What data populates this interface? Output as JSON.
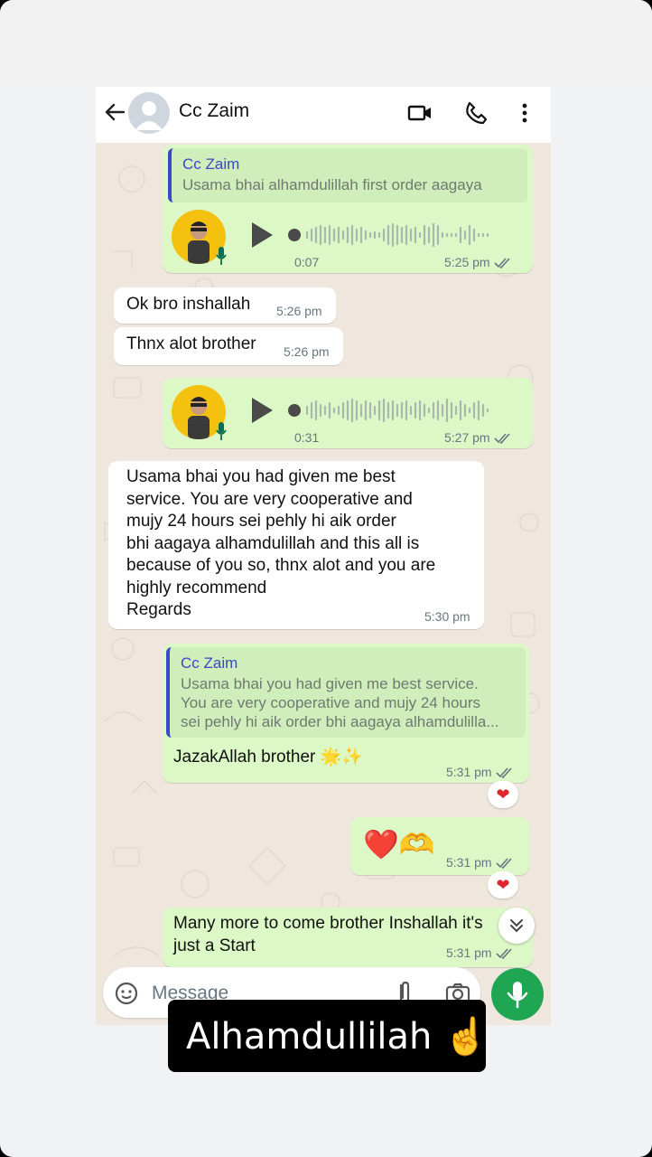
{
  "header": {
    "contact_name": "Cc Zaim"
  },
  "messages": {
    "m1": {
      "quote_name": "Cc Zaim",
      "quote_text": "Usama bhai alhamdulillah first order aagaya",
      "duration": "0:07",
      "time": "5:25 pm"
    },
    "m2": {
      "text": "Ok bro inshallah",
      "time": "5:26 pm"
    },
    "m3": {
      "text": "Thnx alot brother",
      "time": "5:26 pm"
    },
    "m4": {
      "duration": "0:31",
      "time": "5:27 pm"
    },
    "m5": {
      "lines": [
        "Usama bhai you had given me best",
        "service. You are very cooperative and",
        "mujy 24 hours sei pehly hi aik order",
        "bhi aagaya alhamdulillah and this all is",
        "because of you so, thnx alot and you are",
        "highly recommend",
        "Regards"
      ],
      "time": "5:30 pm"
    },
    "m6": {
      "quote_name": "Cc Zaim",
      "quote_lines": [
        "Usama bhai you had given me best service.",
        "You are very cooperative and mujy 24 hours",
        "sei pehly hi aik order bhi aagaya alhamdulilla..."
      ],
      "text": "JazakAllah brother 🌟✨",
      "time": "5:31 pm",
      "reaction": "❤"
    },
    "m7": {
      "text": "❤️🫶",
      "time": "5:31 pm",
      "reaction": "❤"
    },
    "m8": {
      "lines": [
        "Many more to come brother Inshallah it's",
        "just a Start"
      ],
      "time": "5:31 pm"
    }
  },
  "composer": {
    "placeholder": "Message"
  },
  "caption": {
    "text": "Alhamdullilah ☝️"
  },
  "colors": {
    "outgoing": "#dcf8c6",
    "incoming": "#ffffff",
    "accent": "#1fa653",
    "quote_bar": "#3b48c9"
  }
}
